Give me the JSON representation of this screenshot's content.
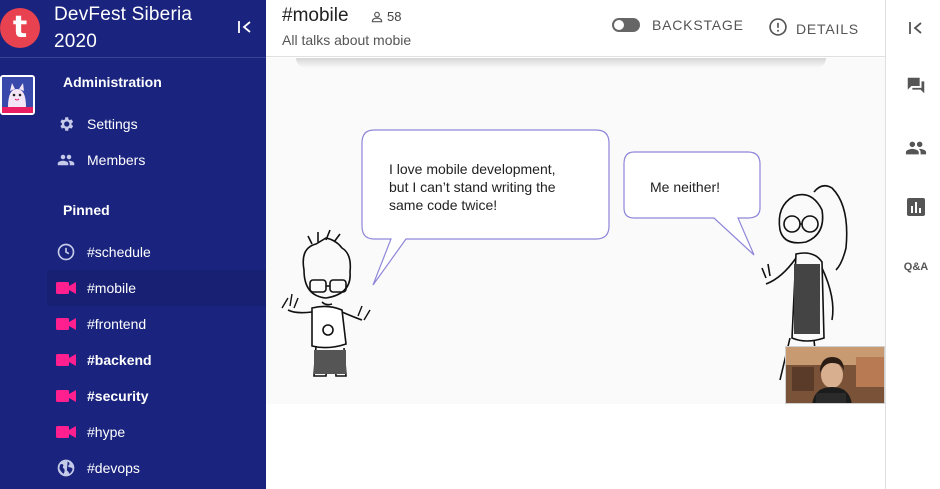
{
  "app": {
    "logo_letter": "t",
    "event_title": "DevFest Siberia 2020"
  },
  "sidebar": {
    "admin_header": "Administration",
    "admin_items": [
      {
        "label": "Settings",
        "icon": "gear-icon"
      },
      {
        "label": "Members",
        "icon": "people-icon"
      }
    ],
    "pinned_header": "Pinned",
    "pinned_items": [
      {
        "label": "#schedule",
        "icon": "clock-icon",
        "bold": false,
        "active": false
      },
      {
        "label": "#mobile",
        "icon": "video-camera-icon",
        "bold": false,
        "active": true
      },
      {
        "label": "#frontend",
        "icon": "video-camera-icon",
        "bold": false,
        "active": false
      },
      {
        "label": "#backend",
        "icon": "video-camera-icon",
        "bold": true,
        "active": false
      },
      {
        "label": "#security",
        "icon": "video-camera-icon",
        "bold": true,
        "active": false
      },
      {
        "label": "#hype",
        "icon": "video-camera-icon",
        "bold": false,
        "active": false
      },
      {
        "label": "#devops",
        "icon": "globe-icon",
        "bold": false,
        "active": false
      }
    ]
  },
  "header": {
    "channel_name": "#mobile",
    "member_count": "58",
    "description": "All talks about mobie",
    "backstage_label": "BACKSTAGE",
    "details_label": "DETAILS"
  },
  "slide": {
    "bubble_left": [
      "I love mobile development,",
      "but I can’t stand writing the",
      "same code twice!"
    ],
    "bubble_right": "Me neither!"
  },
  "right_rail": {
    "icons": [
      "collapse-left-icon",
      "chat-icon",
      "people-icon",
      "poll-chart-icon",
      "qa-icon"
    ],
    "qa_label": "Q&A"
  },
  "colors": {
    "sidebar_bg": "#1a237e",
    "accent_pink": "#ff1f8e",
    "logo_red": "#e8414f"
  }
}
